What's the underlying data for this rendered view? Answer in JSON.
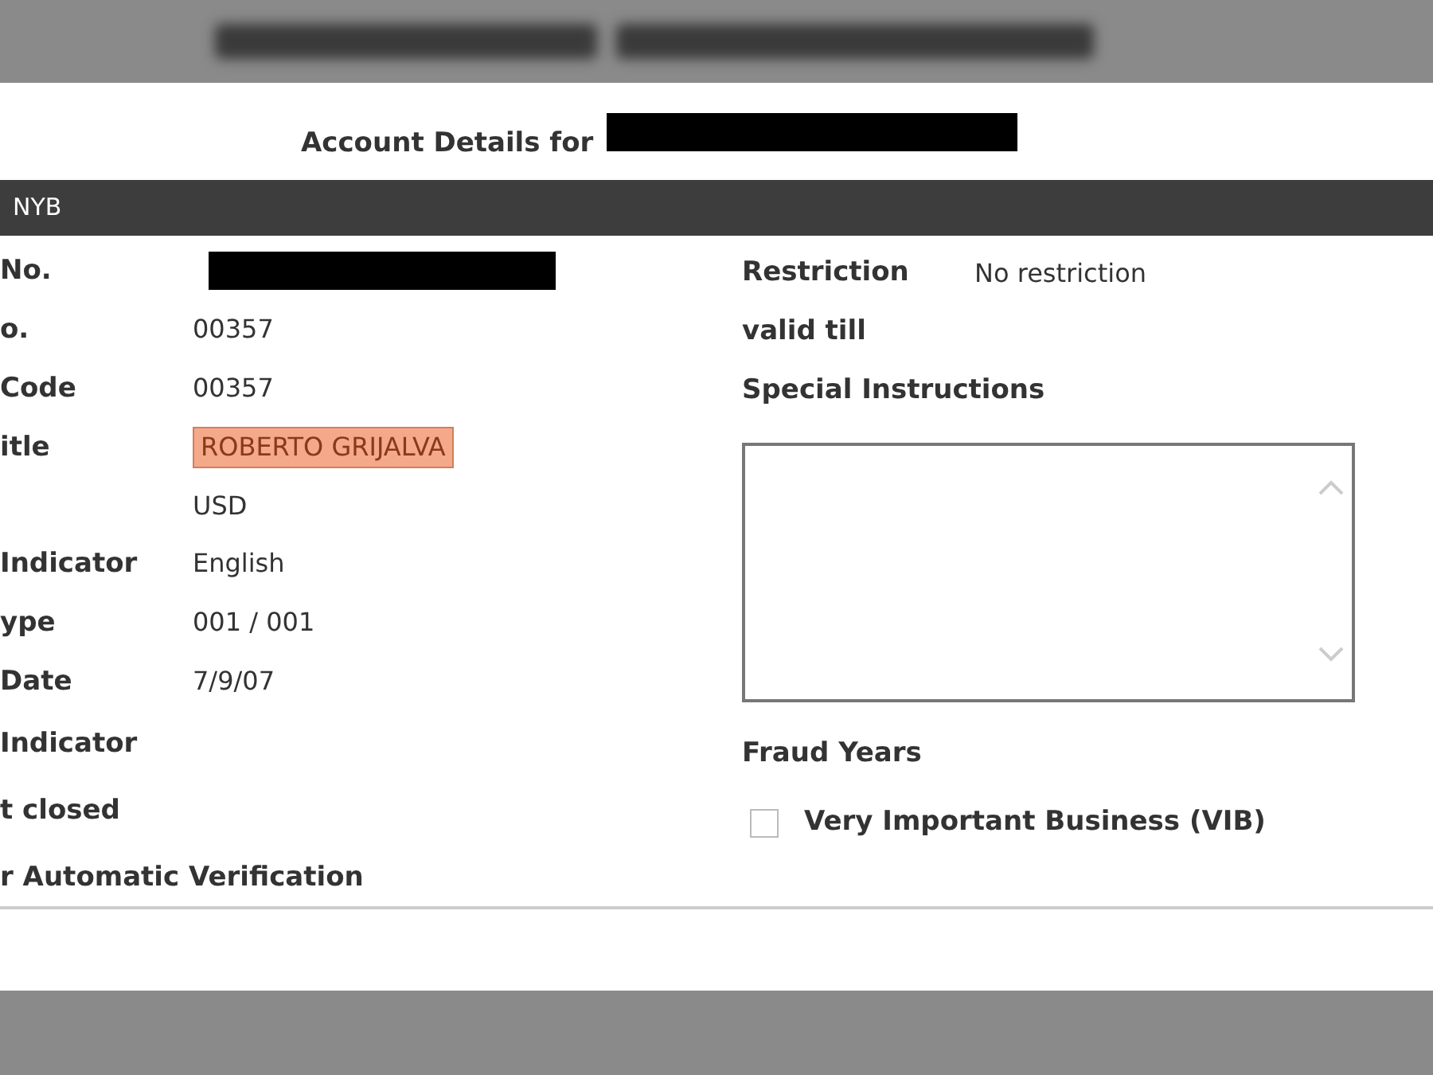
{
  "title": {
    "text": "Account Details  for",
    "redacted": true
  },
  "band": {
    "text": "NYB"
  },
  "left_fields": [
    {
      "label": "No.",
      "redacted": true
    },
    {
      "label": "o.",
      "value": "00357"
    },
    {
      "label": "Code",
      "value": "00357"
    },
    {
      "label": "itle",
      "value": "ROBERTO GRIJALVA",
      "highlighted": true
    },
    {
      "value": "USD"
    },
    {
      "label": "Indicator",
      "value": "English"
    },
    {
      "label": "ype",
      "value": "001 / 001"
    },
    {
      "label": "Date",
      "value": "7/9/07"
    },
    {
      "label": "Indicator"
    },
    {
      "label": "t closed"
    },
    {
      "label": "r Automatic Verification"
    }
  ],
  "right": {
    "restriction_label": "Restriction",
    "restriction_value": "No restriction",
    "valid_till_label": "valid till",
    "special_label": "Special Instructions",
    "fraud_label": "Fraud Years",
    "vib": {
      "label": "Very Important Business (VIB)",
      "checked": false
    }
  }
}
